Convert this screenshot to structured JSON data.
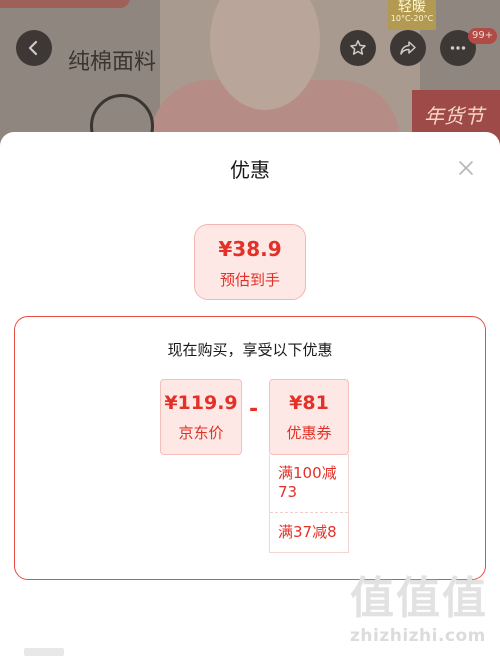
{
  "background": {
    "badge_top": "轻暖",
    "badge_sub": "10°C-20°C",
    "fabric_label": "纯棉面料",
    "promo_text": "年货节",
    "notification_count": "99+"
  },
  "sheet": {
    "title": "优惠"
  },
  "final": {
    "price": "¥38.9",
    "label": "预估到手"
  },
  "breakdown": {
    "title": "现在购买，享受以下优惠",
    "base_price": "¥119.9",
    "base_label": "京东价",
    "operator": "-",
    "discount_amount": "¥81",
    "discount_label": "优惠券",
    "coupons": [
      {
        "text": "满100减73"
      },
      {
        "text": "满37减8"
      }
    ]
  },
  "watermark": {
    "glyphs": "值值值",
    "url": "zhizhizhi.com"
  },
  "colors": {
    "accent": "#e33128",
    "accent_bg": "#fde8e6",
    "border": "#e84c42"
  }
}
